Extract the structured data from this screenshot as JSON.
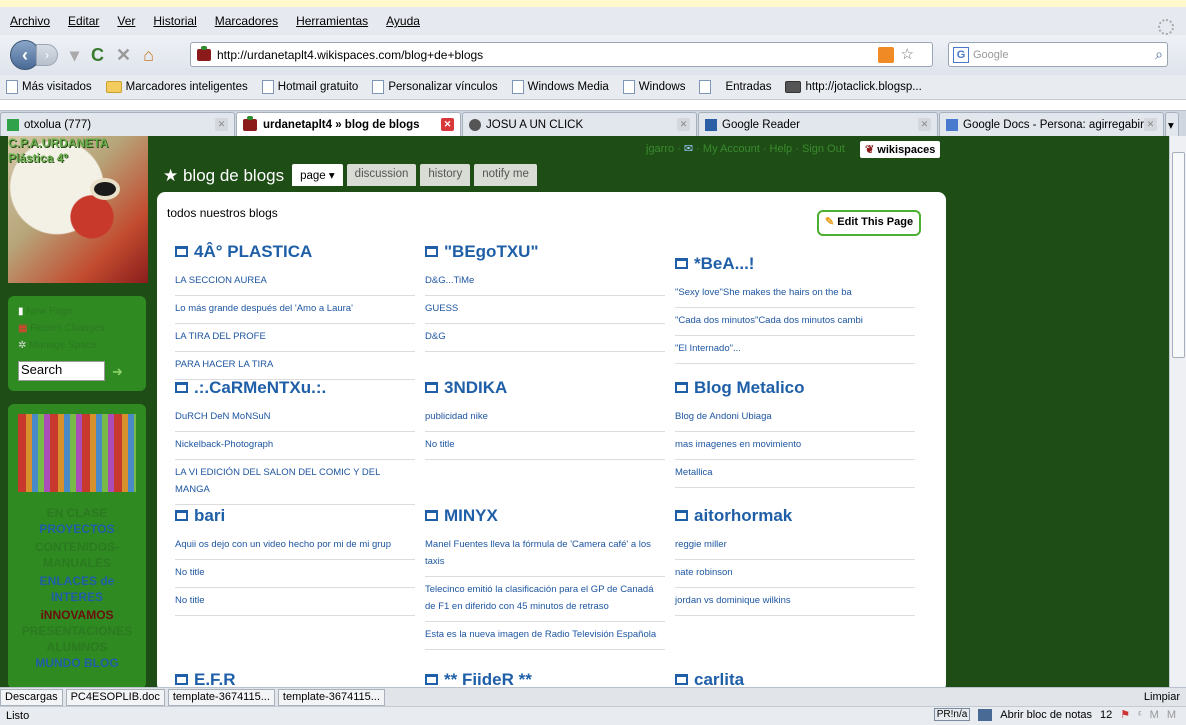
{
  "menu": [
    "Archivo",
    "Editar",
    "Ver",
    "Historial",
    "Marcadores",
    "Herramientas",
    "Ayuda"
  ],
  "url": "http://urdanetaplt4.wikispaces.com/blog+de+blogs",
  "search_placeholder": "Google",
  "bookmarks": [
    "Más visitados",
    "Marcadores inteligentes",
    "Hotmail gratuito",
    "Personalizar vínculos",
    "Windows Media",
    "Windows",
    "",
    "Entradas",
    "http://jotaclick.blogsp..."
  ],
  "tabs": [
    {
      "label": "otxolua (777)"
    },
    {
      "label": "urdanetaplt4 » blog de blogs"
    },
    {
      "label": "JOSU A UN CLICK"
    },
    {
      "label": "Google Reader"
    },
    {
      "label": "Google Docs - Persona: agirregabir..."
    }
  ],
  "site": {
    "logo_line1": "C.P.A.URDANETA",
    "logo_line2": "Plástica 4º",
    "page_title": "blog de blogs",
    "page_tabs": [
      "page",
      "discussion",
      "history",
      "notify me"
    ],
    "top_links": {
      "user": "jgarro",
      "mail": "✉",
      "account": "My Account",
      "help": "Help",
      "signout": "Sign Out"
    },
    "wikispaces": "wikispaces",
    "side_links": [
      "New Page",
      "Recent Changes",
      "Manage Space"
    ],
    "search_value": "Search",
    "side_menu": [
      {
        "label": "EN CLASE",
        "color": "#2b7a1f"
      },
      {
        "label": "PROYECTOS",
        "color": "#1f5fa8"
      },
      {
        "label": "CONTENIDOS-",
        "color": "#2b7a1f"
      },
      {
        "label": "MANUALES",
        "color": "#2b7a1f"
      },
      {
        "label": "ENLACES de",
        "color": "#1f5fa8"
      },
      {
        "label": "INTERES",
        "color": "#1f5fa8"
      },
      {
        "label": "iNNOVAMOS",
        "color": "#6b0f0f"
      },
      {
        "label": "PRESENTACIONES",
        "color": "#2b7a1f"
      },
      {
        "label": "ALUMNOS",
        "color": "#2b7a1f"
      },
      {
        "label": "MUNDO BLOG",
        "color": "#1f5fa8"
      }
    ],
    "subtitle": "todos nuestros blogs",
    "edit_button": "Edit This Page",
    "blogs": [
      {
        "title": "4Â° PLASTICA",
        "items": [
          "LA SECCION AUREA",
          "Lo más grande después del 'Amo a Laura'",
          "LA TIRA DEL PROFE",
          "PARA HACER LA TIRA"
        ]
      },
      {
        "title": "\"BEgoTXU\"",
        "items": [
          "D&G...TiMe",
          "GUESS",
          "D&G"
        ]
      },
      {
        "title": "*BeA...!",
        "items": [
          "\"Sexy love\"She makes the hairs on the ba",
          "\"Cada dos minutos\"Cada dos minutos cambi",
          "\"El Internado\"..."
        ]
      },
      {
        "title": ".:.CaRMeNTXu.:.",
        "items": [
          "DuRCH DeN MoNSuN",
          "Nickelback-Photograph",
          "LA VI EDICIÓN DEL SALON DEL COMIC Y DEL MANGA"
        ]
      },
      {
        "title": "3NDIKA",
        "items": [
          "publicidad nike",
          "No title"
        ]
      },
      {
        "title": "Blog Metalico",
        "items": [
          "Blog de Andoni Ubiaga",
          "mas imagenes en movimiento",
          "Metallica"
        ]
      },
      {
        "title": "bari",
        "items": [
          "Aquii os dejo con un video hecho por mi de mi grup",
          "No title",
          "No title"
        ]
      },
      {
        "title": "MINYX",
        "items": [
          "Manel Fuentes lleva la fórmula de 'Camera café' a los taxis",
          "Telecinco emitió la clasificación para el GP de Canadá de F1 en diferido con 45 minutos de retraso",
          "Esta es la nueva imagen de Radio Televisión Española"
        ]
      },
      {
        "title": "aitorhormak",
        "items": [
          "reggie miller",
          "nate robinson",
          "jordan vs dominique wilkins"
        ]
      },
      {
        "title": "E.F.R",
        "items": []
      },
      {
        "title": "** FiideR **",
        "items": []
      },
      {
        "title": "carlita",
        "items": []
      }
    ]
  },
  "downloads_bar": {
    "label": "Descargas",
    "items": [
      "PC4ESOPLIB.doc",
      "template-3674115...",
      "template-3674115..."
    ],
    "clear": "Limpiar"
  },
  "status": {
    "text": "Listo",
    "ime": "PR!n/a",
    "notes": "Abrir bloc de notas",
    "count": "12"
  }
}
